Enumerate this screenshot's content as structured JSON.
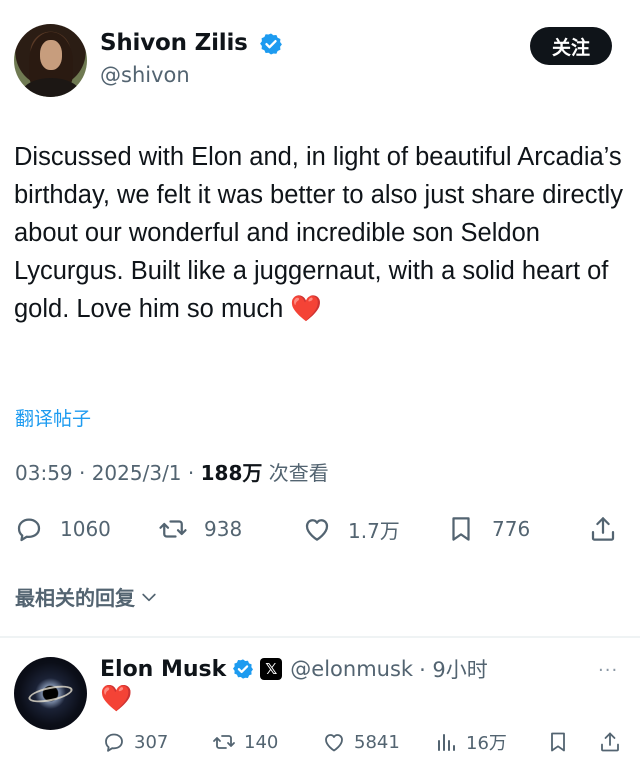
{
  "post": {
    "author_name": "Shivon Zilis",
    "author_handle": "@shivon",
    "follow_label": "关注",
    "text": "Discussed with Elon and, in light of beautiful Arcadia’s birthday, we felt it was better to also just share directly about our wonderful and incredible son Seldon Lycurgus. Built like a juggernaut, with a solid heart of gold. Love him so much",
    "emoji": "❤️",
    "translate_label": "翻译帖子",
    "time": "03:59 · 2025/3/1 · ",
    "views_count": "188万",
    "views_label": " 次查看",
    "stats": {
      "replies": "1060",
      "reposts": "938",
      "likes": "1.7万",
      "bookmarks": "776"
    },
    "icons": [
      "reply-icon",
      "repost-icon",
      "like-icon",
      "bookmark-icon",
      "share-icon"
    ]
  },
  "replies_header": "最相关的回复",
  "reply": {
    "author_name": "Elon Musk",
    "x_badge": "𝕏",
    "author_handle": "@elonmusk",
    "time": "· 9小时",
    "more": "···",
    "text": "❤️",
    "stats": {
      "replies": "307",
      "reposts": "140",
      "likes": "5841",
      "views": "16万"
    }
  },
  "colors": {
    "text": "#0f1419",
    "secondary": "#536471",
    "link": "#1d9bf0",
    "verified": "#1d9bf0",
    "heart": "#e0245e",
    "button_bg": "#0f1419"
  }
}
